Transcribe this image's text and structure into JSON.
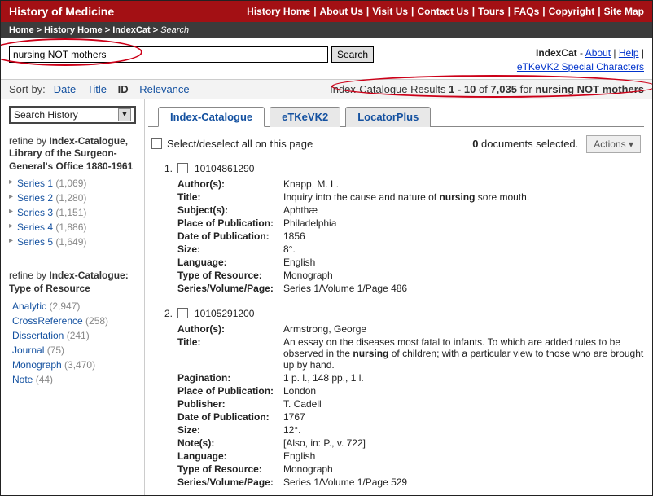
{
  "topbar": {
    "title": "History of Medicine",
    "nav": [
      "History Home",
      "About Us",
      "Visit Us",
      "Contact Us",
      "Tours",
      "FAQs",
      "Copyright",
      "Site Map"
    ]
  },
  "crumb": {
    "home": "Home",
    "p1": "History Home",
    "p2": "IndexCat",
    "cur": "Search"
  },
  "search": {
    "value": "nursing NOT mothers",
    "button": "Search",
    "right_brand": "IndexCat",
    "about": "About",
    "help": "Help",
    "etk": "eTKeVK2 Special Characters"
  },
  "sort": {
    "label": "Sort by:",
    "date": "Date",
    "title": "Title",
    "id": "ID",
    "rel": "Relevance",
    "results_prefix": "Index-Catalogue Results ",
    "range": "1 - 10",
    "of": " of ",
    "total": "7,035",
    "for": " for ",
    "query": "nursing NOT mothers"
  },
  "sidebar": {
    "search_history": "Search History",
    "refine_lbl": "refine by ",
    "group1": "Index-Catalogue, Library of the Surgeon-General's Office 1880-1961",
    "series": [
      {
        "label": "Series 1",
        "count": "(1,069)"
      },
      {
        "label": "Series 2",
        "count": "(1,280)"
      },
      {
        "label": "Series 3",
        "count": "(1,151)"
      },
      {
        "label": "Series 4",
        "count": "(1,886)"
      },
      {
        "label": "Series 5",
        "count": "(1,649)"
      }
    ],
    "group2": "Index-Catalogue: Type of Resource",
    "types": [
      {
        "label": "Analytic",
        "count": "(2,947)"
      },
      {
        "label": "CrossReference",
        "count": "(258)"
      },
      {
        "label": "Dissertation",
        "count": "(241)"
      },
      {
        "label": "Journal",
        "count": "(75)"
      },
      {
        "label": "Monograph",
        "count": "(3,470)"
      },
      {
        "label": "Note",
        "count": "(44)"
      }
    ]
  },
  "tabs": {
    "t1": "Index-Catalogue",
    "t2": "eTKeVK2",
    "t3": "LocatorPlus"
  },
  "selectbar": {
    "sel_label": "Select/deselect all on this page",
    "selected_count": "0",
    "selected_suffix": " documents selected.",
    "actions": "Actions ▾"
  },
  "records": [
    {
      "num": "1.",
      "id": "10104861290",
      "fields": [
        {
          "lab": "Author(s):",
          "val": "Knapp, M. L."
        },
        {
          "lab": "Title:",
          "val": "Inquiry into the cause and nature of <b>nursing</b> sore mouth."
        },
        {
          "lab": "Subject(s):",
          "val": "Aphthæ"
        },
        {
          "lab": "Place of Publication:",
          "val": "Philadelphia"
        },
        {
          "lab": "Date of Publication:",
          "val": "1856"
        },
        {
          "lab": "Size:",
          "val": "8°."
        },
        {
          "lab": "Language:",
          "val": "English"
        },
        {
          "lab": "Type of Resource:",
          "val": "Monograph"
        },
        {
          "lab": "Series/Volume/Page:",
          "val": "Series 1/Volume 1/Page 486"
        }
      ]
    },
    {
      "num": "2.",
      "id": "10105291200",
      "fields": [
        {
          "lab": "Author(s):",
          "val": "Armstrong, George"
        },
        {
          "lab": "Title:",
          "val": "An essay on the diseases most fatal to infants. To which are added rules to be observed in the <b>nursing</b> of children; with a particular view to those who are brought up by hand."
        },
        {
          "lab": "Pagination:",
          "val": "1 p. l., 148 pp., 1 l."
        },
        {
          "lab": "Place of Publication:",
          "val": "London"
        },
        {
          "lab": "Publisher:",
          "val": "T. Cadell"
        },
        {
          "lab": "Date of Publication:",
          "val": "1767"
        },
        {
          "lab": "Size:",
          "val": "12°."
        },
        {
          "lab": "Note(s):",
          "val": "[Also, in: P., v. 722]"
        },
        {
          "lab": "Language:",
          "val": "English"
        },
        {
          "lab": "Type of Resource:",
          "val": "Monograph"
        },
        {
          "lab": "Series/Volume/Page:",
          "val": "Series 1/Volume 1/Page 529"
        }
      ]
    }
  ]
}
